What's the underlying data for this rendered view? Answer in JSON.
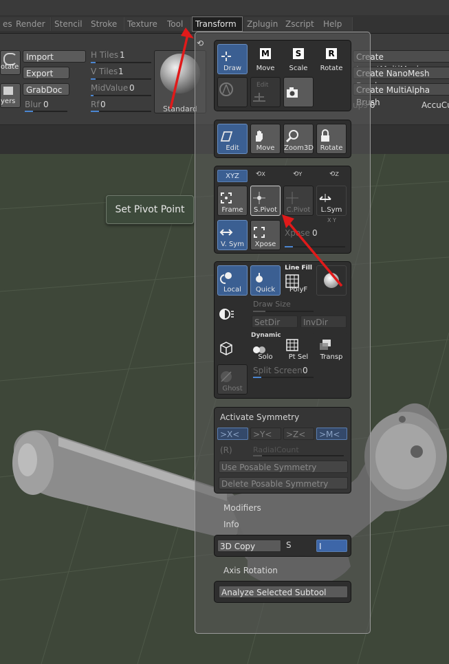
{
  "menu": {
    "items": [
      "es",
      "Render",
      "Stencil",
      "Stroke",
      "Texture",
      "Tool",
      "Transform",
      "Zplugin",
      "Zscript",
      "Help"
    ],
    "active": "Transform"
  },
  "shelf": {
    "left_buttons": [
      "otate",
      "yers"
    ],
    "import_label": "Import",
    "export_label": "Export",
    "grabdoc_label": "GrabDoc",
    "blur_label": "Blur",
    "blur_value": "0",
    "htiles_label": "H Tiles",
    "htiles_value": "1",
    "vtiles_label": "V Tiles",
    "vtiles_value": "1",
    "midvalue_label": "MidValue",
    "midvalue_value": "0",
    "rf_label": "Rf",
    "rf_value": "0",
    "material_label": "Standard",
    "create_insert": "Create InsertMultiMesh",
    "create_nano": "Create NanoMesh Brush",
    "create_alpha": "Create MultiAlpha Brush",
    "ups_label": "ups",
    "ups_value": "0",
    "accucu": "AccuCu"
  },
  "tooltip": "Set Pivot Point",
  "palette": {
    "row1": [
      "Draw",
      "Move",
      "Scale",
      "Rotate"
    ],
    "row1_letters": [
      "",
      "M",
      "S",
      "R"
    ],
    "edit_small": "Edit",
    "row2": [
      "Edit",
      "Move",
      "Zoom3D",
      "Rotate"
    ],
    "sym_axes": [
      "XYZ",
      "X",
      "Y",
      "Z"
    ],
    "row3": [
      "Frame",
      "S.Pivot",
      "C.Pivot",
      "L.Sym"
    ],
    "row4": [
      "V. Sym",
      "Xpose"
    ],
    "xpose_slider_label": "Xpose",
    "xpose_slider_value": "0",
    "small_xy": "X Y",
    "row5": [
      "Local",
      "Quick",
      "PolyF",
      ""
    ],
    "linefill_label": "Line Fill",
    "draw_size_ghost": "Draw Size",
    "setdir": "SetDir",
    "invdir": "InvDir",
    "dynamic_label": "Dynamic",
    "row6": [
      "Solo",
      "Pt Sel",
      "Transp"
    ],
    "split_screen_label": "Split Screen",
    "split_screen_value": "0",
    "ghost_label": "Ghost",
    "activate_symmetry": "Activate Symmetry",
    "sym_buttons": [
      ">X<",
      ">Y<",
      ">Z<",
      ">M<"
    ],
    "r_label": "(R)",
    "radial_ghost": "RadialCount",
    "use_posable": "Use Posable Symmetry",
    "delete_posable": "Delete Posable Symmetry",
    "modifiers": "Modifiers",
    "info": "Info",
    "copy3d": "3D Copy",
    "s_label": "S",
    "i_label": "I",
    "axis_rotation": "Axis Rotation",
    "analyze": "Analyze Selected Subtool"
  },
  "colors": {
    "accent_blue": "#3b5f92",
    "arrow_red": "#e01a1a",
    "viewport_green": "#3e4739"
  }
}
